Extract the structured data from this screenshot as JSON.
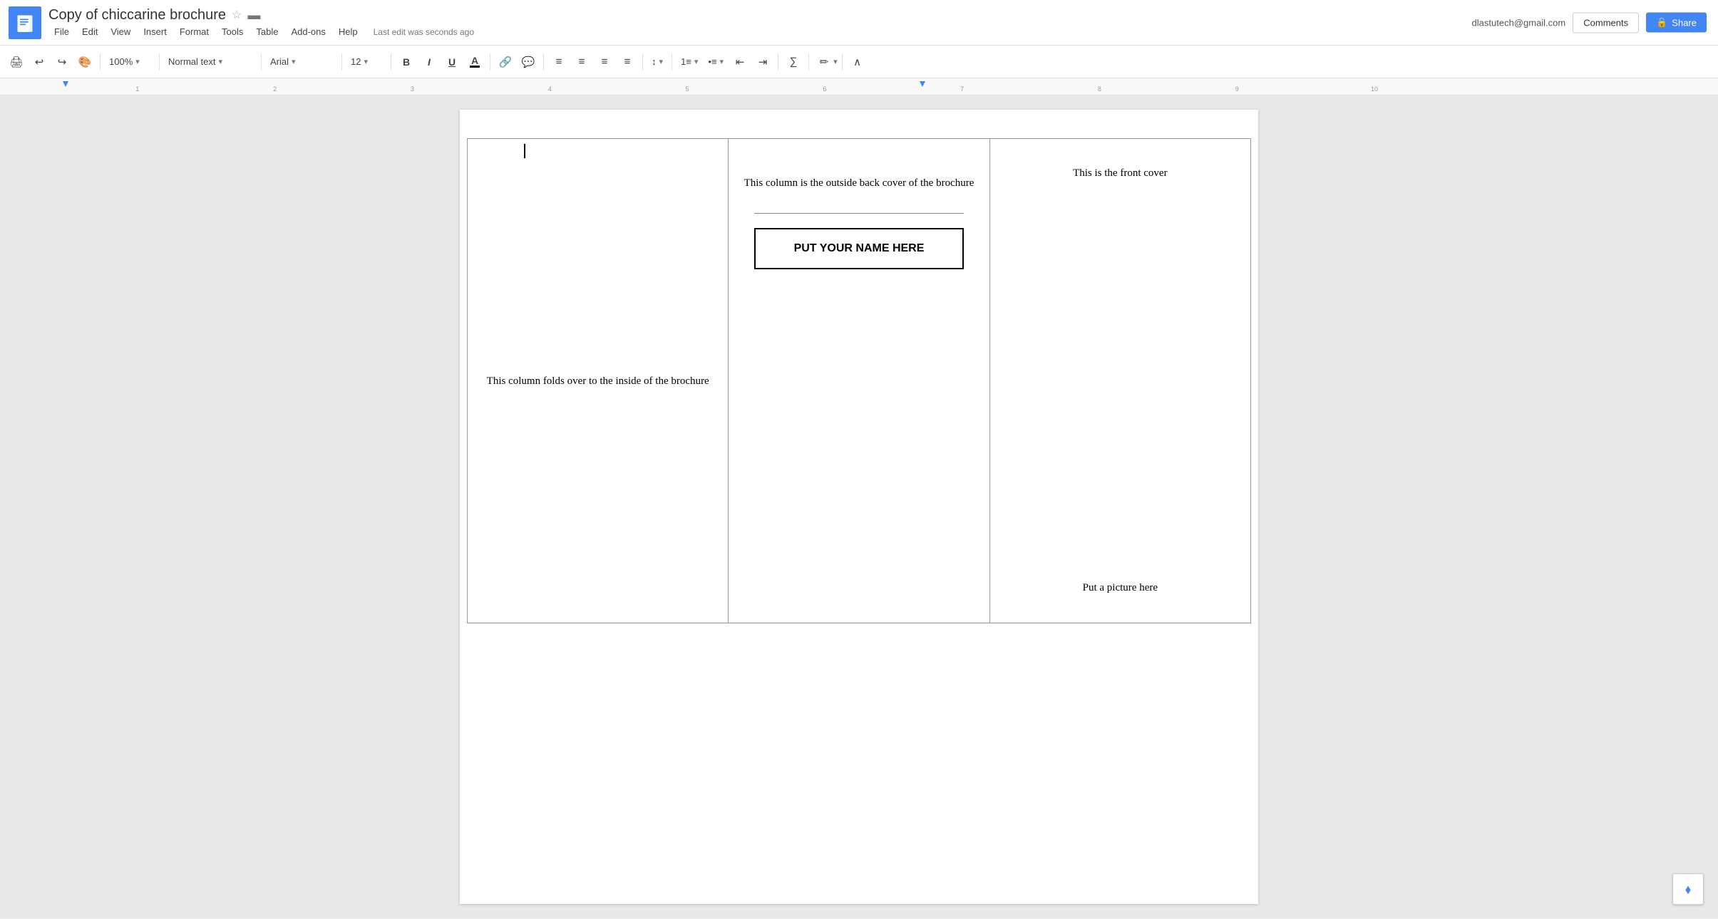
{
  "header": {
    "doc_title": "Copy of chiccarine brochure",
    "user_email": "dlastutech@gmail.com",
    "last_edit": "Last edit was seconds ago",
    "comments_label": "Comments",
    "share_label": "Share"
  },
  "menu": {
    "items": [
      "File",
      "Edit",
      "View",
      "Insert",
      "Format",
      "Tools",
      "Table",
      "Add-ons",
      "Help"
    ]
  },
  "toolbar": {
    "zoom": "100%",
    "style": "Normal text",
    "font": "Arial",
    "size": "12",
    "bold": "B",
    "italic": "I",
    "underline": "U"
  },
  "document": {
    "col1_text": "This column folds over to the inside of the brochure",
    "col2_top_text": "This column is the outside back cover of the brochure",
    "col2_name_label": "PUT YOUR NAME HERE",
    "col3_top_text": "This is the front cover",
    "col3_bottom_text": "Put a picture here"
  }
}
